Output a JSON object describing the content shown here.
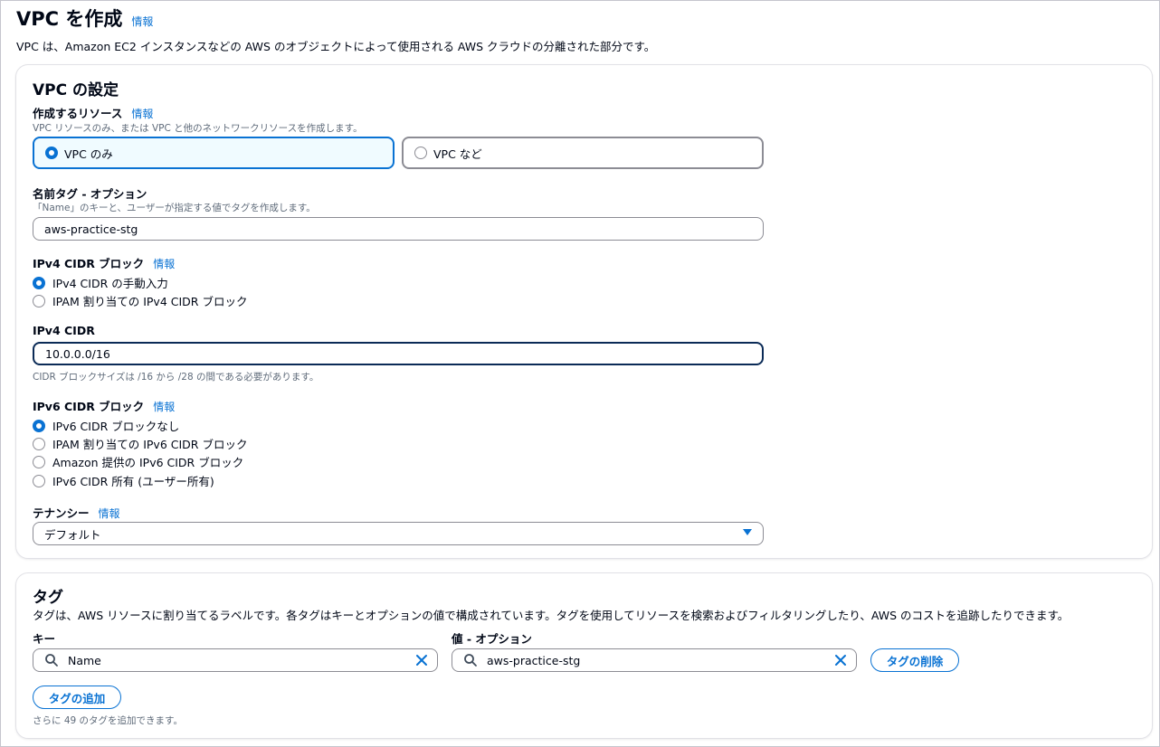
{
  "page": {
    "title": "VPC を作成",
    "info": "情報",
    "description": "VPC は、Amazon EC2 インスタンスなどの AWS のオブジェクトによって使用される AWS クラウドの分離された部分です。"
  },
  "vpc_settings": {
    "title": "VPC の設定",
    "resources": {
      "label": "作成するリソース",
      "info": "情報",
      "hint": "VPC リソースのみ、または VPC と他のネットワークリソースを作成します。",
      "options": [
        {
          "label": "VPC のみ",
          "selected": true
        },
        {
          "label": "VPC など",
          "selected": false
        }
      ]
    },
    "name_tag": {
      "label": "名前タグ - オプション",
      "hint": "「Name」のキーと、ユーザーが指定する値でタグを作成します。",
      "value": "aws-practice-stg"
    },
    "ipv4_block": {
      "label": "IPv4 CIDR ブロック",
      "info": "情報",
      "options": [
        {
          "label": "IPv4 CIDR の手動入力",
          "selected": true
        },
        {
          "label": "IPAM 割り当ての IPv4 CIDR ブロック",
          "selected": false
        }
      ]
    },
    "ipv4_cidr": {
      "label": "IPv4 CIDR",
      "value": "10.0.0.0/16",
      "hint": "CIDR ブロックサイズは /16 から /28 の間である必要があります。"
    },
    "ipv6_block": {
      "label": "IPv6 CIDR ブロック",
      "info": "情報",
      "options": [
        {
          "label": "IPv6 CIDR ブロックなし",
          "selected": true
        },
        {
          "label": "IPAM 割り当ての IPv6 CIDR ブロック",
          "selected": false
        },
        {
          "label": "Amazon 提供の IPv6 CIDR ブロック",
          "selected": false
        },
        {
          "label": "IPv6 CIDR 所有 (ユーザー所有)",
          "selected": false
        }
      ]
    },
    "tenancy": {
      "label": "テナンシー",
      "info": "情報",
      "value": "デフォルト"
    }
  },
  "tags": {
    "title": "タグ",
    "description": "タグは、AWS リソースに割り当てるラベルです。各タグはキーとオプションの値で構成されています。タグを使用してリソースを検索およびフィルタリングしたり、AWS のコストを追跡したりできます。",
    "key_label": "キー",
    "value_label": "値 - オプション",
    "rows": [
      {
        "key": "Name",
        "value": "aws-practice-stg"
      }
    ],
    "remove_button": "タグの削除",
    "add_button": "タグの追加",
    "remaining": "さらに 49 のタグを追加できます。"
  },
  "colors": {
    "accent": "#0972d3",
    "text": "#000716",
    "hint": "#5f6b7a",
    "selected_tile_bg": "#f0fbff"
  }
}
